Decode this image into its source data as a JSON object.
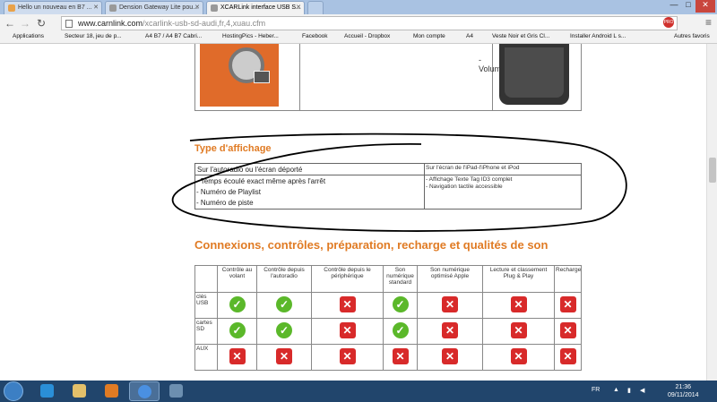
{
  "browser": {
    "tabs": [
      {
        "label": "Hello un nouveau en B7 ..."
      },
      {
        "label": "Dension Gateway Lite pou..."
      },
      {
        "label": "XCARLink interface USB S..."
      }
    ],
    "window_controls": [
      "—",
      "□",
      "✕"
    ],
    "url_host": "www.carnlink.com",
    "url_path": "/xcarlink-usb-sd-audi,fr,4,xuau.cfm",
    "bookmarks": [
      {
        "label": "Applications",
        "color": "#3367d6"
      },
      {
        "label": "Secteur 18, jeu de p...",
        "color": "#c0392b"
      },
      {
        "label": "A4 B7 / A4 B7 Cabri...",
        "color": "#555555"
      },
      {
        "label": "HostingPics - Heber...",
        "color": "#888888"
      },
      {
        "label": "Facebook",
        "color": "#3b5998"
      },
      {
        "label": "Accueil - Dropbox",
        "color": "#2f80ed"
      },
      {
        "label": "Mon compte",
        "color": "#2c6fbb"
      },
      {
        "label": "A4",
        "color": "#e5b84b"
      },
      {
        "label": "Veste Noir et Gris Cl...",
        "color": "#c0392b"
      },
      {
        "label": "Installer Android L s...",
        "color": "#b03030"
      },
      {
        "label": "Autres favoris",
        "color": "#e5b84b"
      }
    ]
  },
  "product": {
    "volume_text": "- Volume..."
  },
  "display_section": {
    "title": "Type d'affichage",
    "header_left": "Sur l'autoradio ou l'écran déporté",
    "header_right": "Sur l'écran de l'iPad-l'iPhone et iPod",
    "left_lines": [
      "- Temps écoulé exact même après l'arrêt",
      "- Numéro de Playlist",
      "- Numéro de piste"
    ],
    "right_lines": [
      "- Affichage Texte Tag ID3 complet",
      "- Navigation tactile accessible"
    ]
  },
  "connections": {
    "title": "Connexions, contrôles, préparation, recharge et qualités de son",
    "columns": [
      "",
      "Contrôle au volant",
      "Contrôle depuis l'autoradio",
      "Contrôle depuis le périphérique",
      "Son numérique standard",
      "Son numérique optimisé Apple",
      "Lecture et classement Plug & Play",
      "Recharge"
    ],
    "rows": [
      {
        "label": "clés USB",
        "values": [
          true,
          true,
          false,
          true,
          false,
          false,
          false
        ]
      },
      {
        "label": "cartes SD",
        "values": [
          true,
          true,
          false,
          true,
          false,
          false,
          false
        ]
      },
      {
        "label": "AUX",
        "values": [
          false,
          false,
          false,
          false,
          false,
          false,
          false
        ]
      }
    ]
  },
  "taskbar": {
    "lang": "FR",
    "time": "21:36",
    "date": "09/11/2014"
  },
  "colors": {
    "accent_orange": "#e07b24",
    "check_green": "#5bb82a",
    "cross_red": "#d82a2a"
  }
}
